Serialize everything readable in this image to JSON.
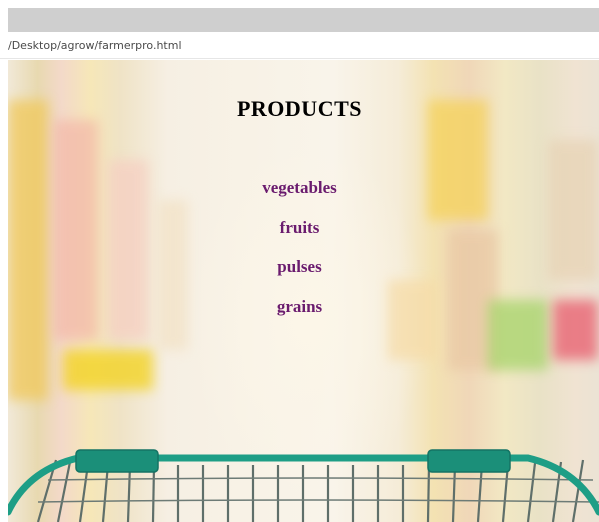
{
  "browser": {
    "url": "/Desktop/agrow/farmerpro.html"
  },
  "page": {
    "title": "PRODUCTS",
    "links": [
      {
        "label": "vegetables"
      },
      {
        "label": "fruits"
      },
      {
        "label": "pulses"
      },
      {
        "label": "grains"
      }
    ]
  },
  "colors": {
    "link": "#6a1b6e",
    "title": "#000000",
    "cart": "#1e9e86"
  },
  "images": {
    "background": "blurred-supermarket-aisle",
    "foreground": "shopping-cart-handle"
  }
}
